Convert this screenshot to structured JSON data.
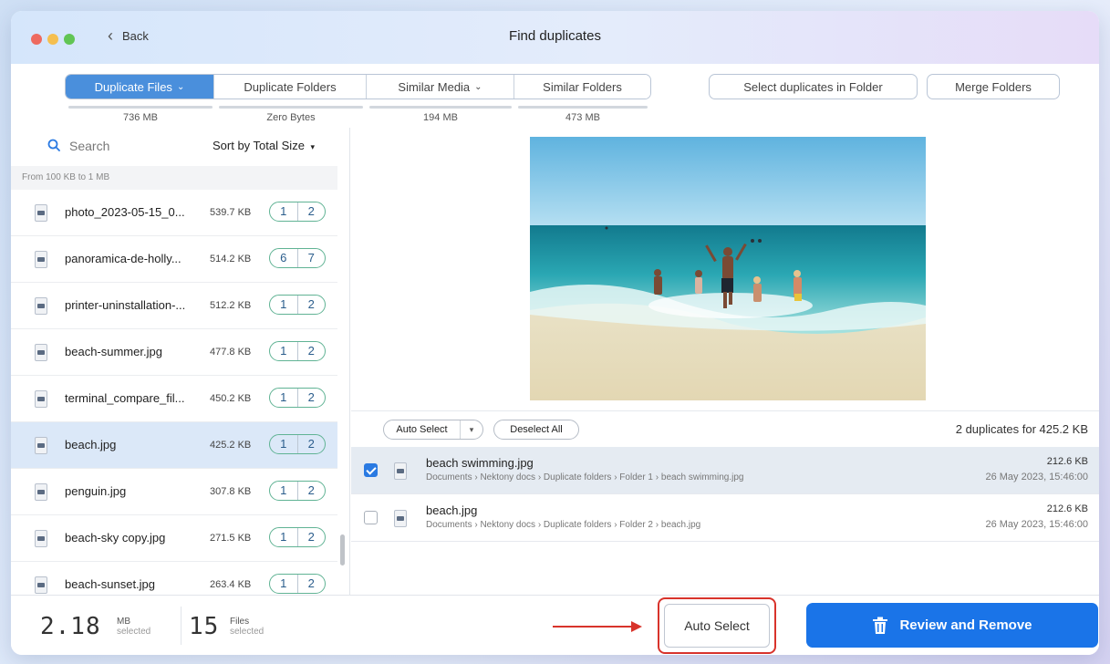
{
  "window": {
    "title": "Find duplicates",
    "back_label": "Back"
  },
  "tabs": [
    {
      "label": "Duplicate Files",
      "size": "736 MB",
      "active": true,
      "has_dropdown": true
    },
    {
      "label": "Duplicate Folders",
      "size": "Zero Bytes",
      "active": false,
      "has_dropdown": false
    },
    {
      "label": "Similar Media",
      "size": "194 MB",
      "active": false,
      "has_dropdown": true
    },
    {
      "label": "Similar Folders",
      "size": "473 MB",
      "active": false,
      "has_dropdown": false
    }
  ],
  "toolbar": {
    "select_in_folder": "Select duplicates in Folder",
    "merge_folders": "Merge Folders"
  },
  "sidebar": {
    "search_placeholder": "Search",
    "sort_label": "Sort by Total Size",
    "group_header": "From 100 KB to 1 MB",
    "items": [
      {
        "name": "photo_2023-05-15_0...",
        "size": "539.7 KB",
        "a": "1",
        "b": "2",
        "selected": false
      },
      {
        "name": "panoramica-de-holly...",
        "size": "514.2 KB",
        "a": "6",
        "b": "7",
        "selected": false
      },
      {
        "name": "printer-uninstallation-...",
        "size": "512.2 KB",
        "a": "1",
        "b": "2",
        "selected": false
      },
      {
        "name": "beach-summer.jpg",
        "size": "477.8 KB",
        "a": "1",
        "b": "2",
        "selected": false
      },
      {
        "name": "terminal_compare_fil...",
        "size": "450.2 KB",
        "a": "1",
        "b": "2",
        "selected": false
      },
      {
        "name": "beach.jpg",
        "size": "425.2 KB",
        "a": "1",
        "b": "2",
        "selected": true
      },
      {
        "name": "penguin.jpg",
        "size": "307.8 KB",
        "a": "1",
        "b": "2",
        "selected": false
      },
      {
        "name": "beach-sky copy.jpg",
        "size": "271.5 KB",
        "a": "1",
        "b": "2",
        "selected": false
      },
      {
        "name": "beach-sunset.jpg",
        "size": "263.4 KB",
        "a": "1",
        "b": "2",
        "selected": false
      }
    ]
  },
  "actions": {
    "auto_select": "Auto Select",
    "deselect_all": "Deselect All",
    "summary": "2 duplicates for 425.2 KB"
  },
  "duplicates": [
    {
      "name": "beach swimming.jpg",
      "path": "Documents › Nektony docs › Duplicate folders › Folder 1 › beach swimming.jpg",
      "size": "212.6 KB",
      "date": "26 May 2023, 15:46:00",
      "checked": true
    },
    {
      "name": "beach.jpg",
      "path": "Documents › Nektony docs › Duplicate folders › Folder 2 › beach.jpg",
      "size": "212.6 KB",
      "date": "26 May 2023, 15:46:00",
      "checked": false
    }
  ],
  "footer": {
    "size_value": "2.18",
    "size_unit": "MB",
    "size_sub": "selected",
    "files_value": "15",
    "files_unit": "Files",
    "files_sub": "selected",
    "auto_select": "Auto Select",
    "review_remove": "Review and Remove"
  },
  "colors": {
    "accent": "#1a74e8",
    "highlight": "#d8332b",
    "tab_active": "#4a8fdc"
  }
}
